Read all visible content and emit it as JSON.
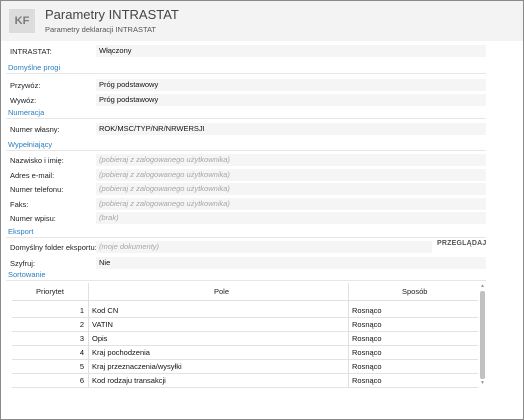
{
  "header": {
    "logo": "KF",
    "title": "Parametry INTRASTAT",
    "subtitle": "Parametry deklaracji INTRASTAT"
  },
  "intrastat": {
    "label": "INTRASTAT:",
    "value": "Włączony"
  },
  "sections": {
    "default_thresholds": "Domyślne progi",
    "numbering": "Numeracja",
    "filler": "Wypełniający",
    "export": "Eksport",
    "sorting": "Sortowanie"
  },
  "thresholds": {
    "import_label": "Przywóz:",
    "import_value": "Próg podstawowy",
    "export_label": "Wywóz:",
    "export_value": "Próg podstawowy"
  },
  "numbering": {
    "own_number_label": "Numer własny:",
    "own_number_value": "ROK/MSC/TYP/NR/NRWERSJI"
  },
  "filler": {
    "name_label": "Nazwisko i imię:",
    "name_placeholder": "(pobieraj z zalogowanego użytkownika)",
    "email_label": "Adres e-mail:",
    "email_placeholder": "(pobieraj z zalogowanego użytkownika)",
    "phone_label": "Numer telefonu:",
    "phone_placeholder": "(pobieraj z zalogowanego użytkownika)",
    "fax_label": "Faks:",
    "fax_placeholder": "(pobieraj z zalogowanego użytkownika)",
    "entry_number_label": "Numer wpisu:",
    "entry_number_placeholder": "(brak)"
  },
  "export": {
    "folder_label": "Domyślny folder eksportu:",
    "folder_placeholder": "(moje dokumenty)",
    "browse_button": "PRZEGLĄDAJ",
    "encrypt_label": "Szyfruj:",
    "encrypt_value": "Nie"
  },
  "sorting_table": {
    "columns": [
      "Priorytet",
      "Pole",
      "Sposób"
    ],
    "rows": [
      {
        "priority": "1",
        "field": "Kod CN",
        "order": "Rosnąco"
      },
      {
        "priority": "2",
        "field": "VATIN",
        "order": "Rosnąco"
      },
      {
        "priority": "3",
        "field": "Opis",
        "order": "Rosnąco"
      },
      {
        "priority": "4",
        "field": "Kraj pochodzenia",
        "order": "Rosnąco"
      },
      {
        "priority": "5",
        "field": "Kraj przeznaczenia/wysyłki",
        "order": "Rosnąco"
      },
      {
        "priority": "6",
        "field": "Kod rodzaju transakcji",
        "order": "Rosnąco"
      }
    ]
  },
  "colors": {
    "section_accent": "#2a7fc0",
    "field_background": "#f5f5f5",
    "placeholder_text": "#a6a6a6",
    "header_background": "#f3f3f3"
  }
}
